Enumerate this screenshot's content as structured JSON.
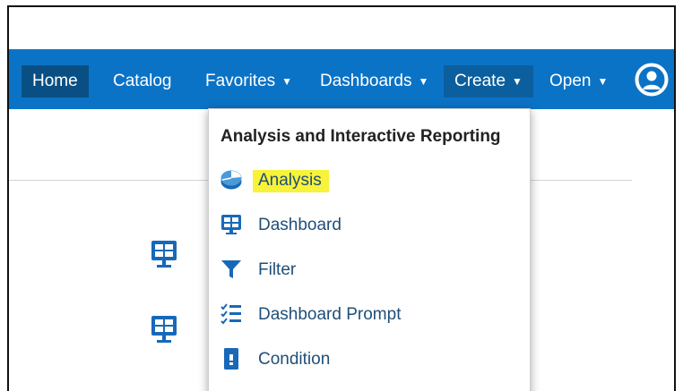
{
  "nav": {
    "home": "Home",
    "catalog": "Catalog",
    "favorites": "Favorites",
    "dashboards": "Dashboards",
    "create": "Create",
    "open": "Open",
    "user_icon": "user-circle-icon"
  },
  "create_menu": {
    "heading": "Analysis and Interactive Reporting",
    "items": [
      {
        "label": "Analysis",
        "icon": "analysis-icon",
        "highlighted": true
      },
      {
        "label": "Dashboard",
        "icon": "dashboard-icon"
      },
      {
        "label": "Filter",
        "icon": "filter-icon"
      },
      {
        "label": "Dashboard Prompt",
        "icon": "dashboard-prompt-icon"
      },
      {
        "label": "Condition",
        "icon": "condition-icon"
      }
    ]
  },
  "colors": {
    "navbar": "#0b73c6",
    "nav_active": "#0a4f83",
    "icon_blue": "#1769b8",
    "highlight": "#f7f23a"
  }
}
